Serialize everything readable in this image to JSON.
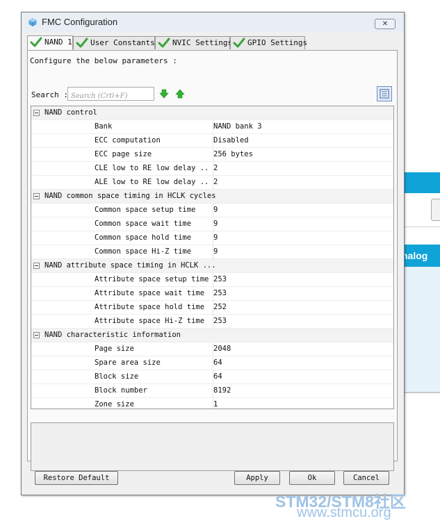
{
  "window": {
    "title": "FMC Configuration",
    "close_label": "✕"
  },
  "tabs": [
    {
      "label": "NAND 1",
      "active": true
    },
    {
      "label": "User Constants",
      "active": false
    },
    {
      "label": "NVIC Settings",
      "active": false
    },
    {
      "label": "GPIO Settings",
      "active": false
    }
  ],
  "configure_label": "Configure the below parameters :",
  "search": {
    "label": "Search :",
    "placeholder": "Search (Crtl+F)"
  },
  "groups": [
    {
      "title": "NAND control",
      "params": [
        {
          "name": "Bank",
          "value": "NAND bank 3"
        },
        {
          "name": "ECC computation",
          "value": "Disabled"
        },
        {
          "name": "ECC page size",
          "value": "256 bytes"
        },
        {
          "name": "CLE low to RE low delay ...",
          "value": "2"
        },
        {
          "name": "ALE low to RE low delay ...",
          "value": "2"
        }
      ]
    },
    {
      "title": "NAND common space timing in HCLK cycles",
      "params": [
        {
          "name": "Common space setup time",
          "value": "9"
        },
        {
          "name": "Common space wait time",
          "value": "9"
        },
        {
          "name": "Common space hold time",
          "value": "9"
        },
        {
          "name": "Common space Hi-Z time",
          "value": "9"
        }
      ]
    },
    {
      "title": "NAND attribute space timing in HCLK ...",
      "params": [
        {
          "name": "Attribute space setup time",
          "value": "253"
        },
        {
          "name": "Attribute space wait time",
          "value": "253"
        },
        {
          "name": "Attribute space hold time",
          "value": "252"
        },
        {
          "name": "Attribute space Hi-Z time",
          "value": "253"
        }
      ]
    },
    {
      "title": "NAND characteristic information",
      "params": [
        {
          "name": "Page size",
          "value": "2048"
        },
        {
          "name": "Spare area size",
          "value": "64"
        },
        {
          "name": "Block size",
          "value": "64"
        },
        {
          "name": "Block number",
          "value": "8192"
        },
        {
          "name": "Zone size",
          "value": "1"
        }
      ]
    }
  ],
  "buttons": {
    "restore_default": "Restore Default",
    "apply": "Apply",
    "ok": "Ok",
    "cancel": "Cancel"
  },
  "background_app": {
    "strip_label": "nalog"
  },
  "watermark": {
    "line1": "STM32/STM8社区",
    "line2": "www.stmcu.org"
  },
  "colors": {
    "check_green": "#3aa33a",
    "arrow_green": "#2fb52f",
    "accent_blue": "#0fa3d8",
    "watermark": "#9fc3e6"
  }
}
